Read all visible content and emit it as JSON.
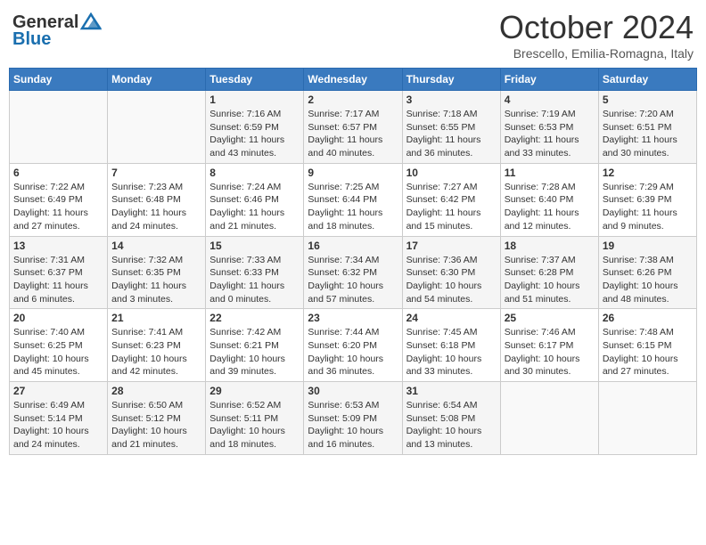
{
  "header": {
    "logo_line1": "General",
    "logo_line2": "Blue",
    "month": "October 2024",
    "location": "Brescello, Emilia-Romagna, Italy"
  },
  "days_of_week": [
    "Sunday",
    "Monday",
    "Tuesday",
    "Wednesday",
    "Thursday",
    "Friday",
    "Saturday"
  ],
  "weeks": [
    [
      {
        "day": "",
        "sunrise": "",
        "sunset": "",
        "daylight": ""
      },
      {
        "day": "",
        "sunrise": "",
        "sunset": "",
        "daylight": ""
      },
      {
        "day": "1",
        "sunrise": "Sunrise: 7:16 AM",
        "sunset": "Sunset: 6:59 PM",
        "daylight": "Daylight: 11 hours and 43 minutes."
      },
      {
        "day": "2",
        "sunrise": "Sunrise: 7:17 AM",
        "sunset": "Sunset: 6:57 PM",
        "daylight": "Daylight: 11 hours and 40 minutes."
      },
      {
        "day": "3",
        "sunrise": "Sunrise: 7:18 AM",
        "sunset": "Sunset: 6:55 PM",
        "daylight": "Daylight: 11 hours and 36 minutes."
      },
      {
        "day": "4",
        "sunrise": "Sunrise: 7:19 AM",
        "sunset": "Sunset: 6:53 PM",
        "daylight": "Daylight: 11 hours and 33 minutes."
      },
      {
        "day": "5",
        "sunrise": "Sunrise: 7:20 AM",
        "sunset": "Sunset: 6:51 PM",
        "daylight": "Daylight: 11 hours and 30 minutes."
      }
    ],
    [
      {
        "day": "6",
        "sunrise": "Sunrise: 7:22 AM",
        "sunset": "Sunset: 6:49 PM",
        "daylight": "Daylight: 11 hours and 27 minutes."
      },
      {
        "day": "7",
        "sunrise": "Sunrise: 7:23 AM",
        "sunset": "Sunset: 6:48 PM",
        "daylight": "Daylight: 11 hours and 24 minutes."
      },
      {
        "day": "8",
        "sunrise": "Sunrise: 7:24 AM",
        "sunset": "Sunset: 6:46 PM",
        "daylight": "Daylight: 11 hours and 21 minutes."
      },
      {
        "day": "9",
        "sunrise": "Sunrise: 7:25 AM",
        "sunset": "Sunset: 6:44 PM",
        "daylight": "Daylight: 11 hours and 18 minutes."
      },
      {
        "day": "10",
        "sunrise": "Sunrise: 7:27 AM",
        "sunset": "Sunset: 6:42 PM",
        "daylight": "Daylight: 11 hours and 15 minutes."
      },
      {
        "day": "11",
        "sunrise": "Sunrise: 7:28 AM",
        "sunset": "Sunset: 6:40 PM",
        "daylight": "Daylight: 11 hours and 12 minutes."
      },
      {
        "day": "12",
        "sunrise": "Sunrise: 7:29 AM",
        "sunset": "Sunset: 6:39 PM",
        "daylight": "Daylight: 11 hours and 9 minutes."
      }
    ],
    [
      {
        "day": "13",
        "sunrise": "Sunrise: 7:31 AM",
        "sunset": "Sunset: 6:37 PM",
        "daylight": "Daylight: 11 hours and 6 minutes."
      },
      {
        "day": "14",
        "sunrise": "Sunrise: 7:32 AM",
        "sunset": "Sunset: 6:35 PM",
        "daylight": "Daylight: 11 hours and 3 minutes."
      },
      {
        "day": "15",
        "sunrise": "Sunrise: 7:33 AM",
        "sunset": "Sunset: 6:33 PM",
        "daylight": "Daylight: 11 hours and 0 minutes."
      },
      {
        "day": "16",
        "sunrise": "Sunrise: 7:34 AM",
        "sunset": "Sunset: 6:32 PM",
        "daylight": "Daylight: 10 hours and 57 minutes."
      },
      {
        "day": "17",
        "sunrise": "Sunrise: 7:36 AM",
        "sunset": "Sunset: 6:30 PM",
        "daylight": "Daylight: 10 hours and 54 minutes."
      },
      {
        "day": "18",
        "sunrise": "Sunrise: 7:37 AM",
        "sunset": "Sunset: 6:28 PM",
        "daylight": "Daylight: 10 hours and 51 minutes."
      },
      {
        "day": "19",
        "sunrise": "Sunrise: 7:38 AM",
        "sunset": "Sunset: 6:26 PM",
        "daylight": "Daylight: 10 hours and 48 minutes."
      }
    ],
    [
      {
        "day": "20",
        "sunrise": "Sunrise: 7:40 AM",
        "sunset": "Sunset: 6:25 PM",
        "daylight": "Daylight: 10 hours and 45 minutes."
      },
      {
        "day": "21",
        "sunrise": "Sunrise: 7:41 AM",
        "sunset": "Sunset: 6:23 PM",
        "daylight": "Daylight: 10 hours and 42 minutes."
      },
      {
        "day": "22",
        "sunrise": "Sunrise: 7:42 AM",
        "sunset": "Sunset: 6:21 PM",
        "daylight": "Daylight: 10 hours and 39 minutes."
      },
      {
        "day": "23",
        "sunrise": "Sunrise: 7:44 AM",
        "sunset": "Sunset: 6:20 PM",
        "daylight": "Daylight: 10 hours and 36 minutes."
      },
      {
        "day": "24",
        "sunrise": "Sunrise: 7:45 AM",
        "sunset": "Sunset: 6:18 PM",
        "daylight": "Daylight: 10 hours and 33 minutes."
      },
      {
        "day": "25",
        "sunrise": "Sunrise: 7:46 AM",
        "sunset": "Sunset: 6:17 PM",
        "daylight": "Daylight: 10 hours and 30 minutes."
      },
      {
        "day": "26",
        "sunrise": "Sunrise: 7:48 AM",
        "sunset": "Sunset: 6:15 PM",
        "daylight": "Daylight: 10 hours and 27 minutes."
      }
    ],
    [
      {
        "day": "27",
        "sunrise": "Sunrise: 6:49 AM",
        "sunset": "Sunset: 5:14 PM",
        "daylight": "Daylight: 10 hours and 24 minutes."
      },
      {
        "day": "28",
        "sunrise": "Sunrise: 6:50 AM",
        "sunset": "Sunset: 5:12 PM",
        "daylight": "Daylight: 10 hours and 21 minutes."
      },
      {
        "day": "29",
        "sunrise": "Sunrise: 6:52 AM",
        "sunset": "Sunset: 5:11 PM",
        "daylight": "Daylight: 10 hours and 18 minutes."
      },
      {
        "day": "30",
        "sunrise": "Sunrise: 6:53 AM",
        "sunset": "Sunset: 5:09 PM",
        "daylight": "Daylight: 10 hours and 16 minutes."
      },
      {
        "day": "31",
        "sunrise": "Sunrise: 6:54 AM",
        "sunset": "Sunset: 5:08 PM",
        "daylight": "Daylight: 10 hours and 13 minutes."
      },
      {
        "day": "",
        "sunrise": "",
        "sunset": "",
        "daylight": ""
      },
      {
        "day": "",
        "sunrise": "",
        "sunset": "",
        "daylight": ""
      }
    ]
  ]
}
